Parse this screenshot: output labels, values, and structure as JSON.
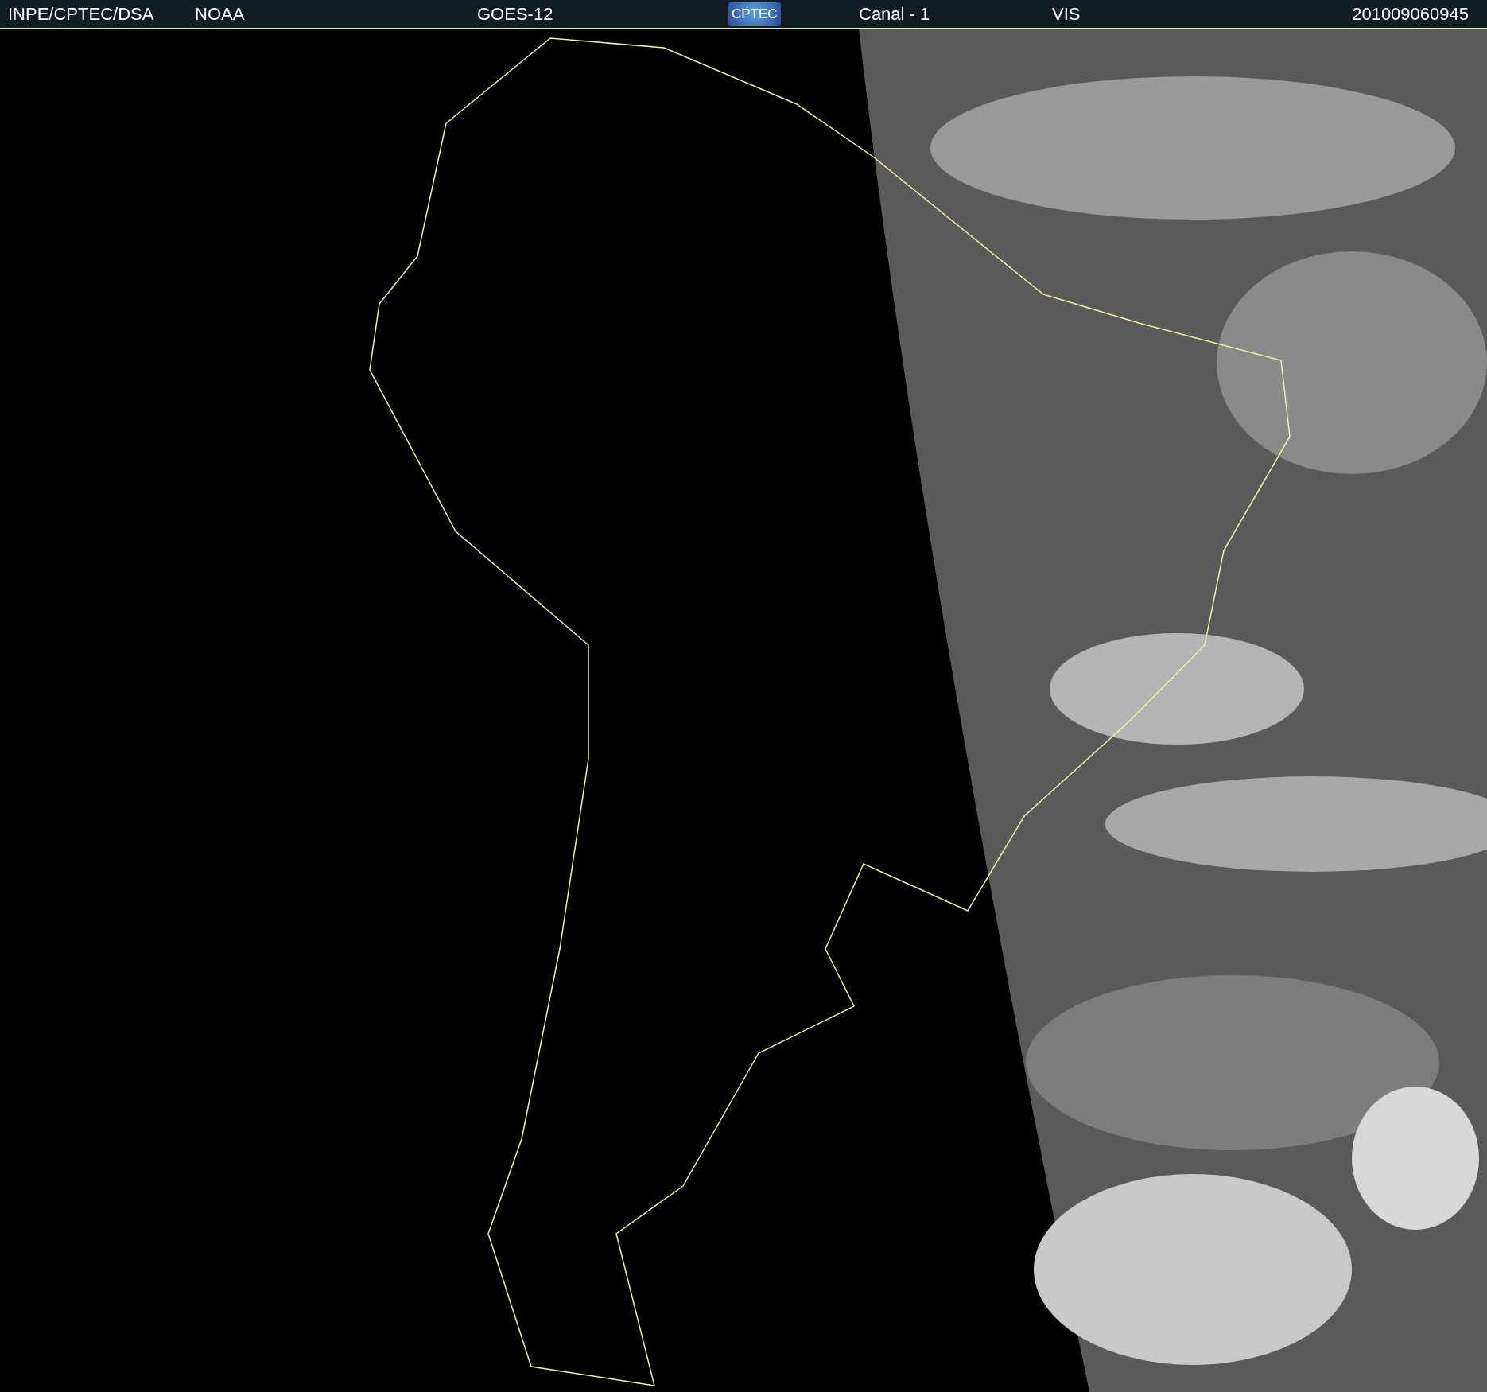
{
  "header": {
    "source": "INPE/CPTEC/DSA",
    "agency": "NOAA",
    "satellite": "GOES-12",
    "logo": "CPTEC",
    "channel": "Canal - 1",
    "band": "VIS",
    "timestamp": "201009060945"
  }
}
